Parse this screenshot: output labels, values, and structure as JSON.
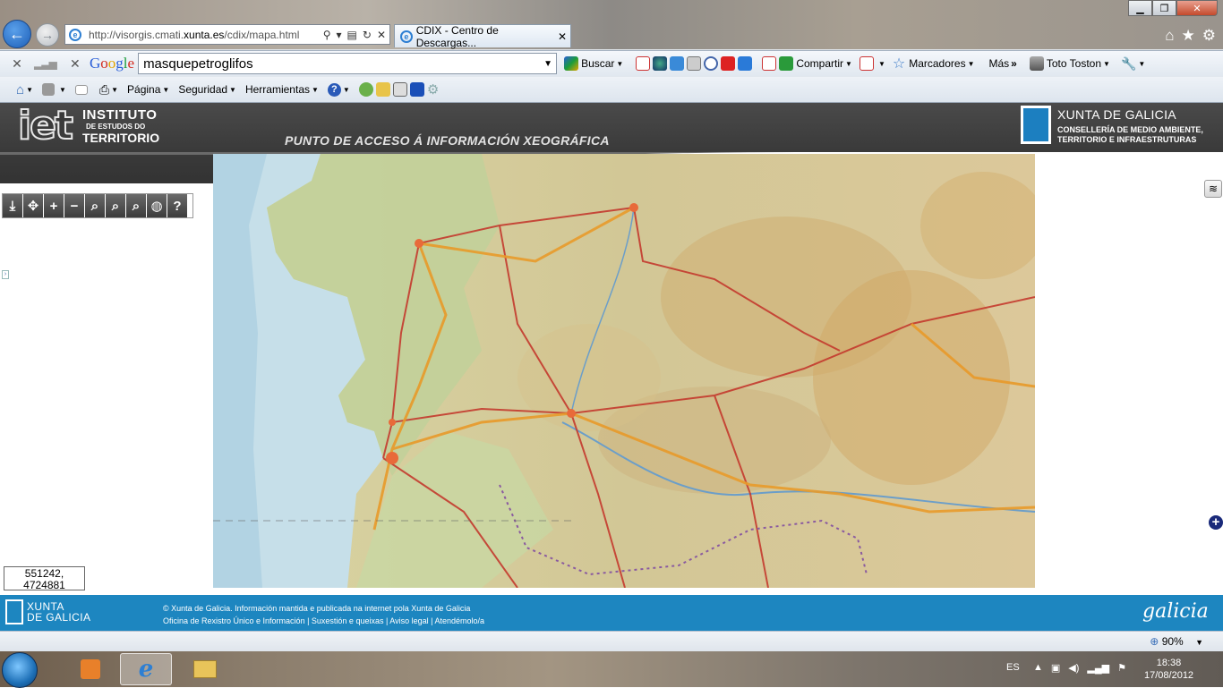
{
  "browser": {
    "url_prefix": "http://visorgis.cmati.",
    "url_domain": "xunta.es",
    "url_suffix": "/cdix/mapa.html",
    "tab_title": "CDIX - Centro de Descargas...",
    "tab_close": "✕"
  },
  "google_toolbar": {
    "logo": "Google",
    "search_value": "masquepetroglifos",
    "search_label": "Buscar",
    "share_label": "Compartir",
    "bookmarks_label": "Marcadores",
    "more_label": "Más",
    "user_label": "Toto Toston"
  },
  "command_bar": {
    "page_label": "Página",
    "security_label": "Seguridad",
    "tools_label": "Herramientas"
  },
  "header": {
    "logo_text": "iet",
    "org_line1": "INSTITUTO",
    "org_line2": "DE ESTUDOS DO",
    "org_line3": "TERRITORIO",
    "portal_title": "PUNTO DE ACCESO Á  INFORMACIÓN XEOGRÁFICA",
    "xunta_title": "XUNTA DE GALICIA",
    "dept_line1": "CONSELLERÍA DE MEDIO AMBIENTE,",
    "dept_line2": "TERRITORIO E INFRAESTRUTURAS"
  },
  "map_tools": [
    {
      "name": "download-tool",
      "icon": "download-icon",
      "glyph": "⤓"
    },
    {
      "name": "pan-tool",
      "icon": "pan-icon",
      "glyph": "✥"
    },
    {
      "name": "zoom-in-tool",
      "icon": "plus-icon",
      "glyph": "+"
    },
    {
      "name": "zoom-out-tool",
      "icon": "minus-icon",
      "glyph": "−"
    },
    {
      "name": "zoom-box-tool",
      "icon": "zoom-box-icon",
      "glyph": "⌕"
    },
    {
      "name": "zoom-prev-tool",
      "icon": "zoom-previous-icon",
      "glyph": "⌕"
    },
    {
      "name": "zoom-full-tool",
      "icon": "zoom-full-icon",
      "glyph": "⌕"
    },
    {
      "name": "globe-tool",
      "icon": "globe-icon",
      "glyph": "◍"
    },
    {
      "name": "help-tool",
      "icon": "help-icon",
      "glyph": "?"
    }
  ],
  "map": {
    "coords_x": "551242,",
    "coords_y": "4724881"
  },
  "footer": {
    "logo_line1": "XUNTA",
    "logo_line2": "DE GALICIA",
    "copyright": "© Xunta de Galicia. Información mantida e publicada na internet pola Xunta de Galicia",
    "links": "Oficina de Rexistro Único e Información | Suxestión e queixas | Aviso legal | Atendémolo/a",
    "brand": "galicia"
  },
  "status": {
    "zoom": "90%"
  },
  "taskbar": {
    "lang": "ES",
    "time": "18:38",
    "date": "17/08/2012"
  }
}
